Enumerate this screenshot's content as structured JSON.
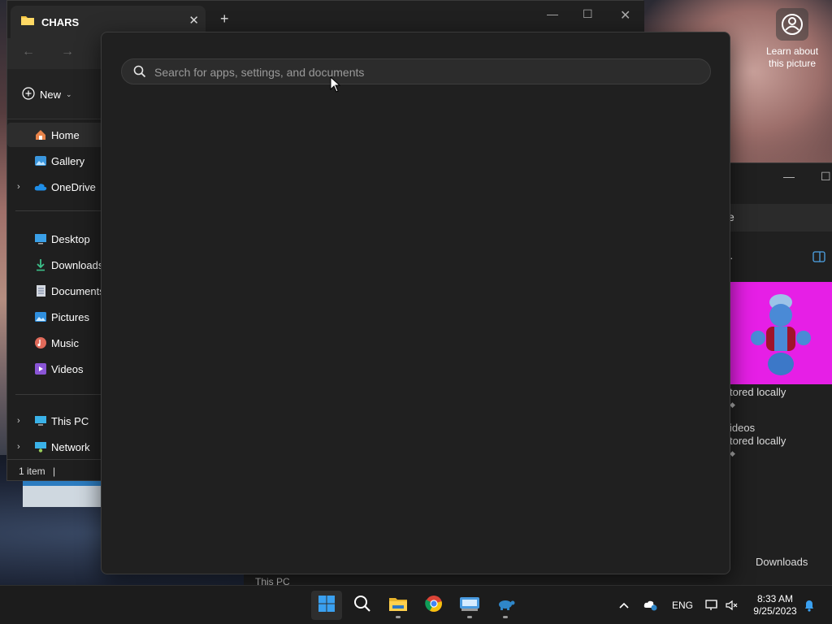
{
  "desktop": {
    "learn_label": "Learn about this picture"
  },
  "back_window": {
    "address_partial": "e",
    "item1_status": "tored locally",
    "item2_name": "ideos",
    "item2_status": "tored locally",
    "bottom_nav_item": "This PC",
    "downloads_label": "Downloads",
    "card_color": "#e61fe6"
  },
  "explorer": {
    "tab_title": "CHARS",
    "new_label": "New",
    "sidebar": [
      {
        "label": "Home",
        "icon": "home-icon"
      },
      {
        "label": "Gallery",
        "icon": "gallery-icon"
      },
      {
        "label": "OneDrive",
        "icon": "onedrive-icon"
      },
      {
        "label": "Desktop",
        "icon": "desktop-icon"
      },
      {
        "label": "Downloads",
        "icon": "downloads-icon"
      },
      {
        "label": "Documents",
        "icon": "documents-icon"
      },
      {
        "label": "Pictures",
        "icon": "pictures-icon"
      },
      {
        "label": "Music",
        "icon": "music-icon"
      },
      {
        "label": "Videos",
        "icon": "videos-icon"
      },
      {
        "label": "This PC",
        "icon": "this-pc-icon"
      },
      {
        "label": "Network",
        "icon": "network-icon"
      }
    ],
    "status": "1 item"
  },
  "search": {
    "placeholder": "Search for apps, settings, and documents",
    "value": ""
  },
  "taskbar": {
    "apps": [
      {
        "name": "start",
        "icon": "windows-logo-icon"
      },
      {
        "name": "search",
        "icon": "search-icon"
      },
      {
        "name": "file-explorer",
        "icon": "folder-icon"
      },
      {
        "name": "chrome",
        "icon": "chrome-icon"
      },
      {
        "name": "app",
        "icon": "keyboard-app-icon"
      },
      {
        "name": "app",
        "icon": "turtle-app-icon"
      }
    ],
    "language": "ENG",
    "time": "8:33 AM",
    "date": "9/25/2023"
  },
  "colors": {
    "accent": "#0078d4",
    "flyout_bg": "#202020",
    "taskbar_bg": "#1c1c1c"
  }
}
